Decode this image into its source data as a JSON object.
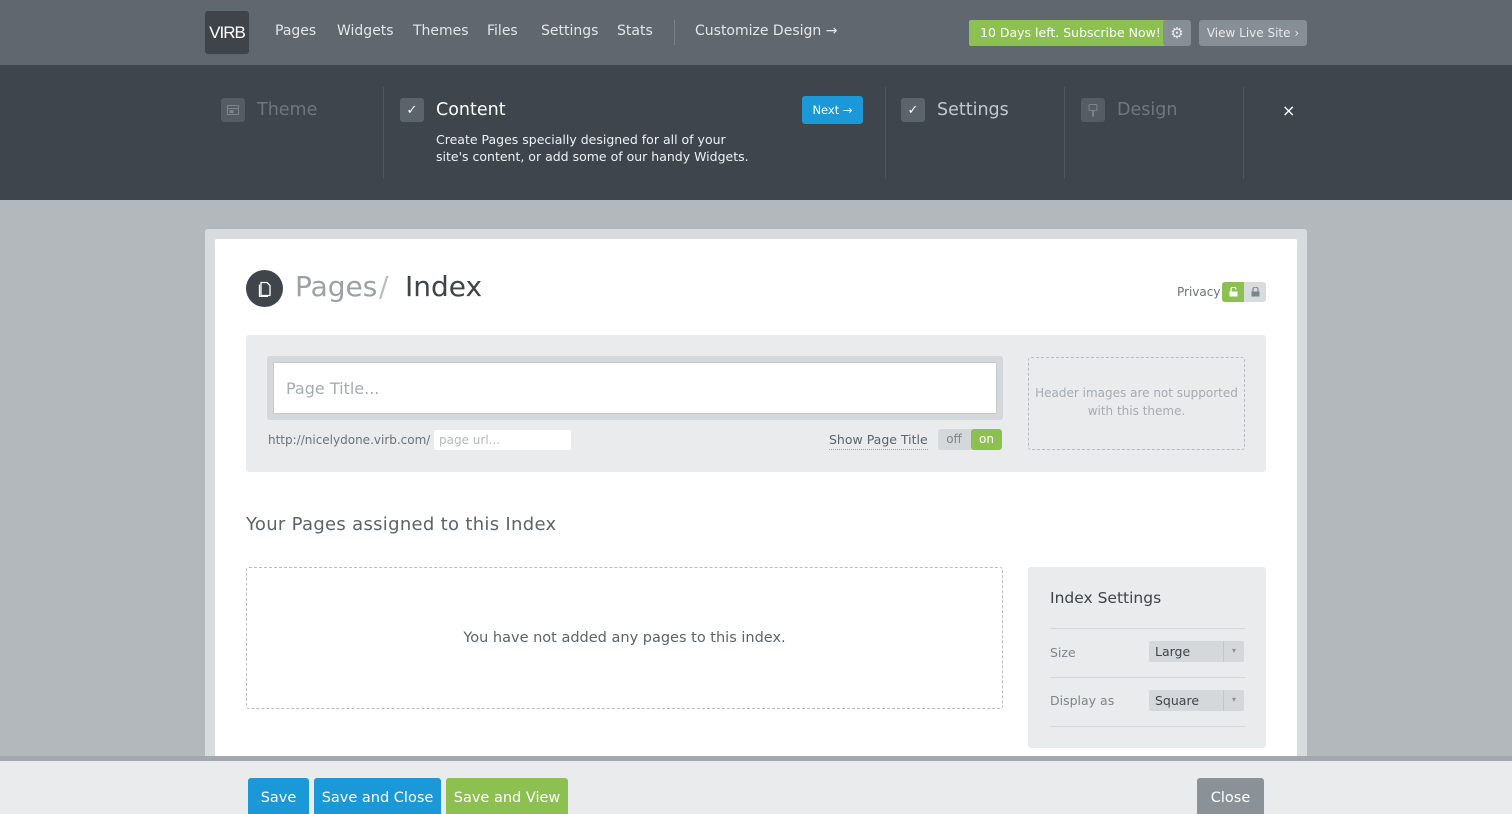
{
  "nav": {
    "logo": "VIRB",
    "items": [
      "Pages",
      "Widgets",
      "Themes",
      "Files",
      "Settings",
      "Stats"
    ],
    "customize": "Customize Design →",
    "subscribe": "10 Days left. Subscribe Now!",
    "view_live": "View Live Site ›"
  },
  "steps": {
    "theme": "Theme",
    "content": "Content",
    "content_desc": "Create Pages specially designed for all of your site's content, or add some of our handy Widgets.",
    "next": "Next →",
    "settings": "Settings",
    "design": "Design",
    "close": "×"
  },
  "breadcrumb": {
    "parent": "Pages",
    "separator": "/",
    "current": "Index"
  },
  "privacy": {
    "label": "Privacy"
  },
  "page_form": {
    "title_placeholder": "Page Title...",
    "title_value": "",
    "url_prefix": "http://nicelydone.virb.com/",
    "url_placeholder": "page url...",
    "url_value": "",
    "show_title_label": "Show Page Title",
    "toggle_off": "off",
    "toggle_on": "on",
    "header_images_note": "Header images are not supported with this theme."
  },
  "assigned": {
    "heading": "Your Pages assigned to this Index",
    "empty": "You have not added any pages to this index."
  },
  "index_settings": {
    "title": "Index Settings",
    "size_label": "Size",
    "size_value": "Large",
    "display_label": "Display as",
    "display_value": "Square"
  },
  "actions": {
    "save": "Save",
    "save_close": "Save and Close",
    "save_view": "Save and View",
    "close": "Close"
  },
  "colors": {
    "accent_blue": "#1a98d8",
    "accent_green": "#8cc152",
    "nav_bg": "#60676e",
    "steps_bg": "#3e454c"
  }
}
